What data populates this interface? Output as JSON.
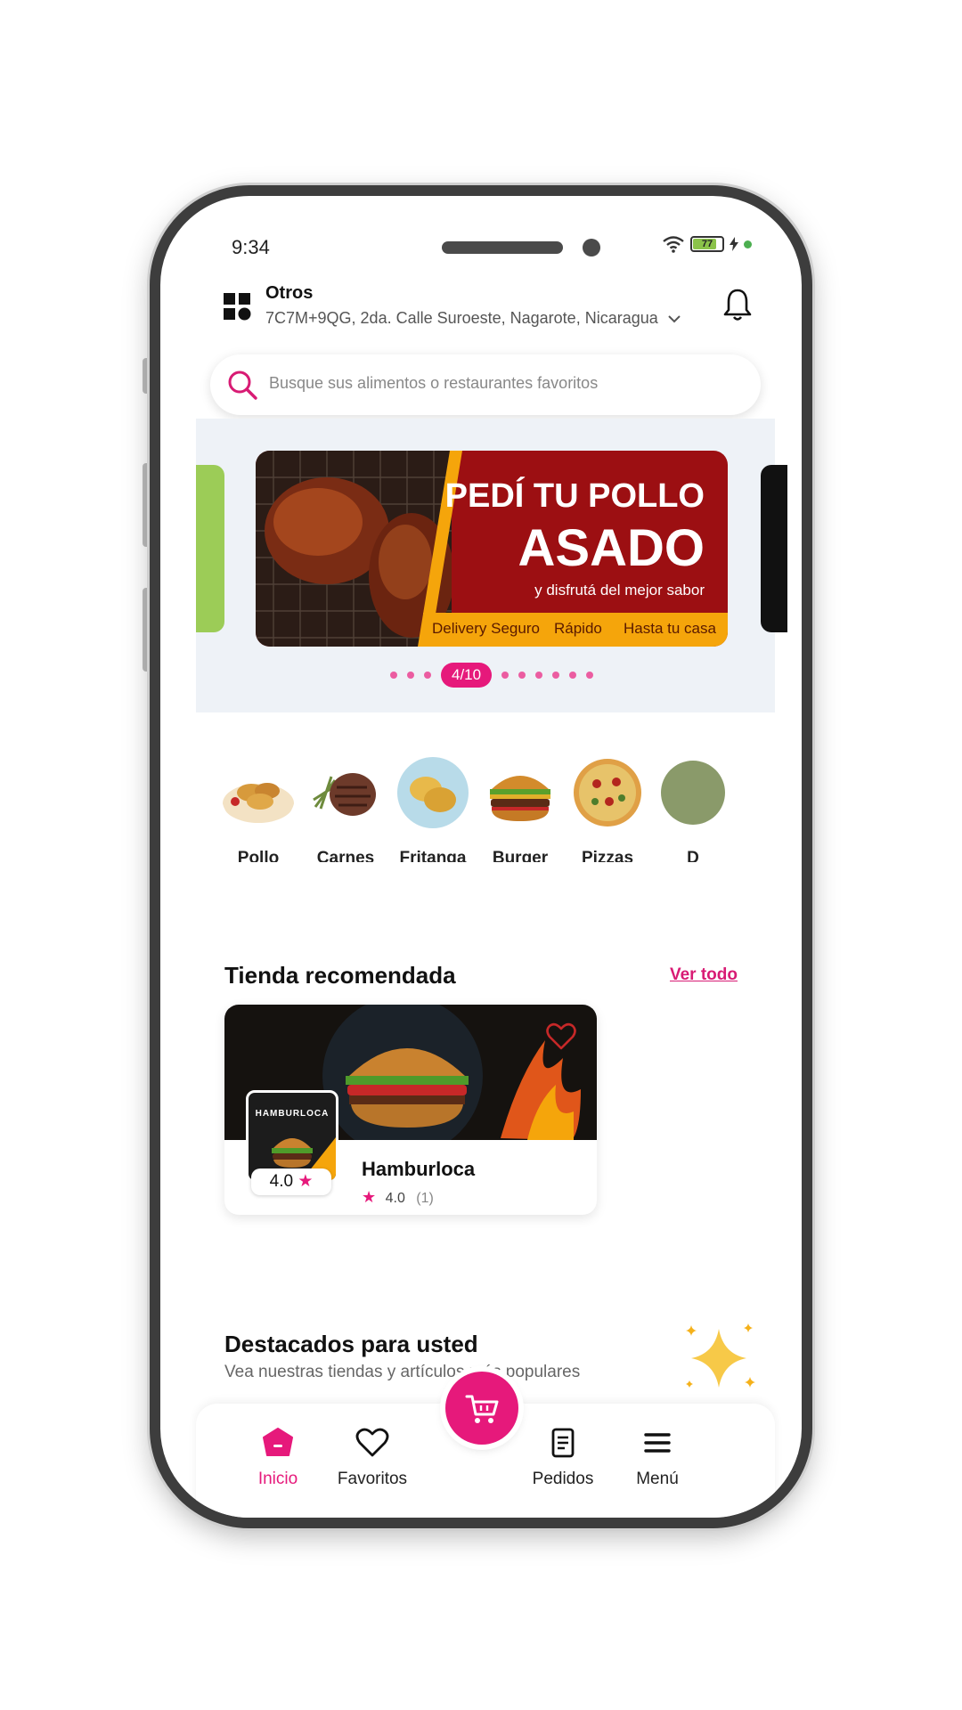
{
  "status_bar": {
    "time": "9:34",
    "battery": "77"
  },
  "header": {
    "location_title": "Otros",
    "location_address": "7C7M+9QG, 2da. Calle Suroeste, Nagarote, Nicaragua"
  },
  "search": {
    "placeholder": "Busque sus alimentos o restaurantes favoritos"
  },
  "banner": {
    "title_line1": "PEDÍ TU POLLO",
    "title_line2": "ASADO",
    "subtitle": "y disfrutá del mejor sabor",
    "tags": [
      "Delivery Seguro",
      "Rápido",
      "Hasta tu casa"
    ],
    "page_indicator": "4/10"
  },
  "categories": [
    {
      "label": "Pollo",
      "icon": "chicken-icon"
    },
    {
      "label": "Carnes",
      "icon": "steak-icon"
    },
    {
      "label": "Fritanga",
      "icon": "fritanga-icon"
    },
    {
      "label": "Burger",
      "icon": "burger-icon"
    },
    {
      "label": "Pizzas",
      "icon": "pizza-icon"
    },
    {
      "label": "D",
      "icon": "partial-category-icon"
    }
  ],
  "recommended": {
    "title": "Tienda recomendada",
    "see_all": "Ver todo",
    "store": {
      "name": "Hamburloca",
      "logo_text": "HAMBURLOCA",
      "logo_rating": "4.0",
      "rating": "4.0",
      "review_count": "(1)"
    }
  },
  "featured": {
    "title": "Destacados para usted",
    "subtitle": "Vea nuestras tiendas y artículos más populares"
  },
  "bottom_nav": {
    "items": [
      {
        "label": "Inicio",
        "icon": "home-icon",
        "active": true
      },
      {
        "label": "Favoritos",
        "icon": "heart-icon",
        "active": false
      },
      {
        "label": "Pedidos",
        "icon": "orders-icon",
        "active": false
      },
      {
        "label": "Menú",
        "icon": "menu-icon",
        "active": false
      }
    ],
    "cart_icon": "cart-icon"
  },
  "colors": {
    "accent": "#e6197b",
    "banner_red": "#9c0f12",
    "banner_strip": "#f5a50b"
  }
}
